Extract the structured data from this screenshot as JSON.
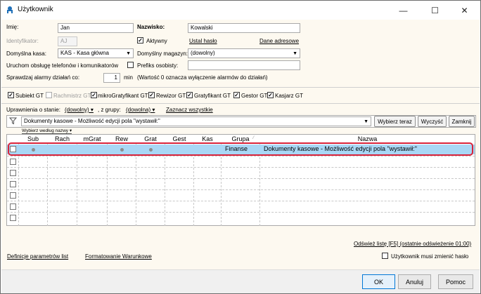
{
  "window": {
    "title": "Użytkownik",
    "minimize": "—",
    "maximize": "☐",
    "close": "✕"
  },
  "form": {
    "imie_label": "Imię:",
    "imie_value": "Jan",
    "nazwisko_label": "Nazwisko:",
    "nazwisko_value": "Kowalski",
    "identyfikator_label": "Identyfikator:",
    "identyfikator_value": "AJ",
    "aktywny_label": "Aktywny",
    "ustal_haslo": "Ustal hasło",
    "dane_adresowe": "Dane adresowe",
    "domyslna_kasa_label": "Domyślna kasa:",
    "domyslna_kasa_value": "KAS - Kasa główna",
    "domyslny_magazyn_label": "Domyślny magazyn:",
    "domyslny_magazyn_value": "(dowolny)",
    "uruchom_label": "Uruchom obsługę telefonów i komunikatorów",
    "prefiks_label": "Prefiks osobisty:",
    "prefiks_value": "",
    "sprawdzaj_label": "Sprawdzaj alarmy działań co:",
    "sprawdzaj_value": "1",
    "min_label": "min",
    "sprawdzaj_note": "(Wartość 0 oznacza wyłączenie alarmów do działań)"
  },
  "modules": [
    {
      "label": "Subiekt GT",
      "checked": true,
      "disabled": false
    },
    {
      "label": "Rachmistrz GT",
      "checked": false,
      "disabled": true
    },
    {
      "label": "mikroGratyfikant GT",
      "checked": true,
      "disabled": false
    },
    {
      "label": "Rewizor GT",
      "checked": true,
      "disabled": false
    },
    {
      "label": "Gratyfikant GT",
      "checked": true,
      "disabled": false
    },
    {
      "label": "Gestor GT",
      "checked": true,
      "disabled": false
    },
    {
      "label": "Kasjarz GT",
      "checked": true,
      "disabled": false
    }
  ],
  "permissions": {
    "stan_label": "Uprawnienia o stanie:",
    "stan_value": "(dowolny)",
    "grupa_label": ", z grupy:",
    "grupa_value": "(dowolna)",
    "zaznacz_label": "Zaznacz wszystkie",
    "filter_value": "Dokumenty kasowe - Możliwość edycji pola \"wystawił:\"",
    "wybierz_teraz": "Wybierz teraz",
    "wyczysc": "Wyczyść",
    "zamknij": "Zamknij",
    "wybierz_wedlug": "Wybierz według nazwy"
  },
  "grid": {
    "columns": [
      "Sub",
      "Rach",
      "mGrat",
      "Rew",
      "Grat",
      "Gest",
      "Kas",
      "Grupa",
      "Nazwa"
    ],
    "rows": [
      {
        "sub": true,
        "rach": false,
        "mgrat": false,
        "rew": true,
        "grat": true,
        "gest": false,
        "kas": false,
        "grupa": "Finanse",
        "nazwa": "Dokumenty kasowe - Możliwość edycji pola \"wystawił:\"",
        "selected": true
      }
    ],
    "empty_rows": 6
  },
  "bottom": {
    "odswiez": "Odśwież listę [F5] (ostatnie odświeżenie 01:00)",
    "musi_zmienic": "Użytkownik musi zmienić hasło",
    "definicje": "Definicje parametrów list",
    "formatowanie": "Formatowanie Warunkowe"
  },
  "footer": {
    "ok": "OK",
    "anuluj": "Anuluj",
    "pomoc": "Pomoc"
  },
  "colors": {
    "selected_row": "#a9d7f5",
    "highlight_border": "#d9233a",
    "form_bg": "#fdf9f0"
  }
}
